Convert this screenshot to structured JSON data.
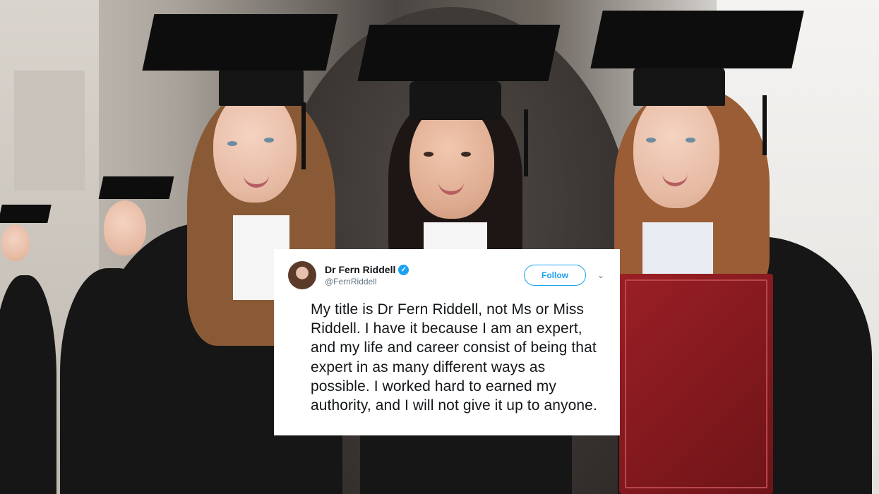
{
  "tweet": {
    "display_name": "Dr Fern Riddell",
    "handle": "@FernRiddell",
    "follow_label": "Follow",
    "verified_icon": "✓",
    "chevron_icon": "⌄",
    "text": "My title is Dr Fern Riddell, not Ms or Miss Riddell. I have it because I am an expert, and my life and career consist of being that expert in as many different ways as possible. I worked hard to earned my authority, and I will not give it up to anyone."
  },
  "colors": {
    "twitter_blue": "#1da1f2",
    "text_primary": "#14171a",
    "text_secondary": "#657786",
    "gown": "#161616",
    "folder": "#8b1b21"
  },
  "icons": {
    "verified": "verified-badge-icon",
    "chevron": "chevron-down-icon"
  }
}
